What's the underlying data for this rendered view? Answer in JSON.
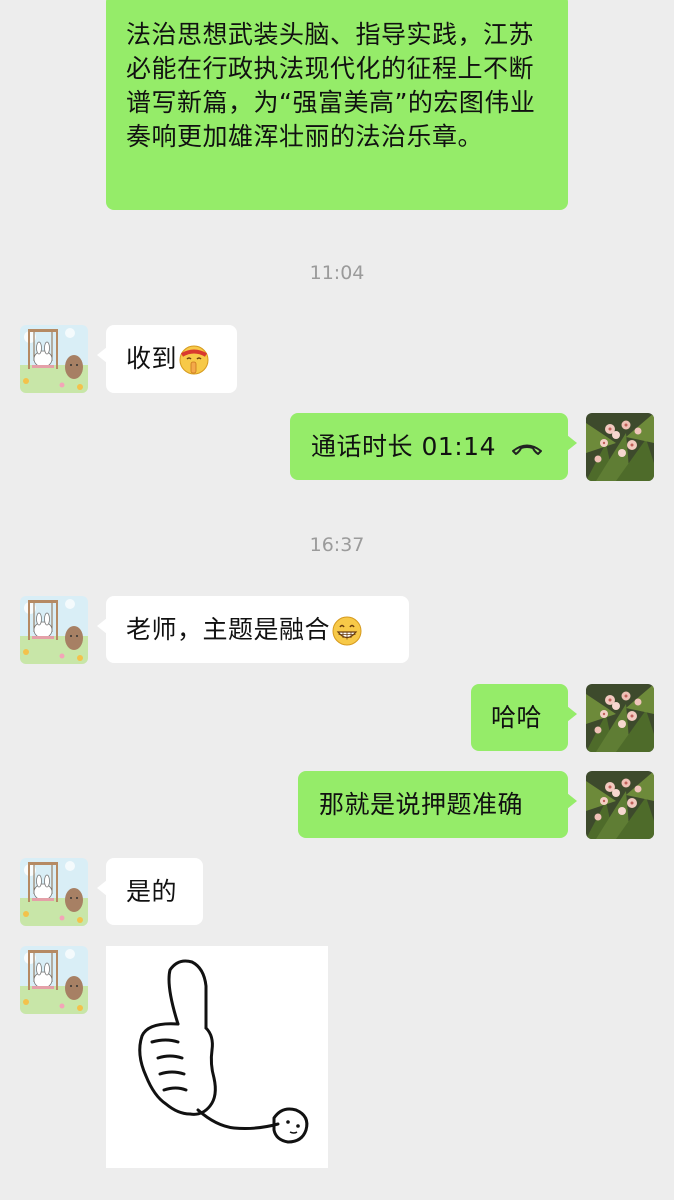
{
  "messages": {
    "m1_text": "法治思想武装头脑、指导实践，江苏必能在行政执法现代化的征程上不断谱写新篇，为“强富美高”的宏图伟业奏响更加雄浑壮丽的法治乐章。",
    "time1": "11:04",
    "m2_text": "收到",
    "m2_emoji": "shushing-face-emoji",
    "m3_text": "通话时长 01:14",
    "m3_icon": "phone-hangup-icon",
    "time2": "16:37",
    "m4_text": "老师，主题是融合",
    "m4_emoji": "grinning-face-emoji",
    "m5_text": "哈哈",
    "m6_text": "那就是说押题准确",
    "m7_text": "是的",
    "m8_sticker": "thumbs-up-sticker"
  },
  "colors": {
    "background": "#ededed",
    "sent_bubble": "#95ec69",
    "received_bubble": "#ffffff",
    "timestamp": "#9b9b9b"
  },
  "avatars": {
    "contact": "bunny-swing-avatar",
    "self": "flower-avatar"
  }
}
